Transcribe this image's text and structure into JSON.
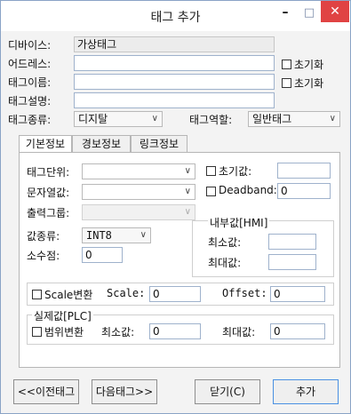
{
  "window": {
    "title": "태그 추가",
    "minimize": "–",
    "maximize": "□",
    "close": "✕"
  },
  "fields": {
    "device_label": "디바이스:",
    "device_value": "가상태그",
    "address_label": "어드레스:",
    "address_value": "",
    "tagname_label": "태그이름:",
    "tagname_value": "",
    "tagdesc_label": "태그설명:",
    "tagdesc_value": "",
    "tagtype_label": "태그종류:",
    "tagtype_value": "디지탈",
    "tagrole_label": "태그역할:",
    "tagrole_value": "일반태그",
    "reset1_label": "초기화",
    "reset2_label": "초기화"
  },
  "tabs": [
    "기본정보",
    "경보정보",
    "링크정보"
  ],
  "basic": {
    "unit_label": "태그단위:",
    "unit_value": "",
    "string_label": "문자열값:",
    "string_value": "",
    "output_group_label": "출력그룹:",
    "output_group_value": "",
    "init_label": "초기값:",
    "init_value": "",
    "deadband_label": "Deadband:",
    "deadband_value": "0",
    "hmi_group_label": "내부값[HMI]",
    "min_label": "최소값:",
    "min_value": "",
    "max_label": "최대값:",
    "max_value": "",
    "valtype_label": "값종류:",
    "valtype_value": "INT8",
    "decimal_label": "소수점:",
    "decimal_value": "0",
    "scale_check_label": "Scale변환",
    "scale_label": "Scale:",
    "scale_value": "0",
    "offset_label": "Offset:",
    "offset_value": "0",
    "plc_group_label": "실제값[PLC]",
    "range_check_label": "범위변환",
    "plc_min_label": "최소값:",
    "plc_min_value": "0",
    "plc_max_label": "최대값:",
    "plc_max_value": "0"
  },
  "buttons": {
    "prev": "<<이전태그",
    "next": "다음태그>>",
    "close": "닫기(C)",
    "add": "추가"
  }
}
